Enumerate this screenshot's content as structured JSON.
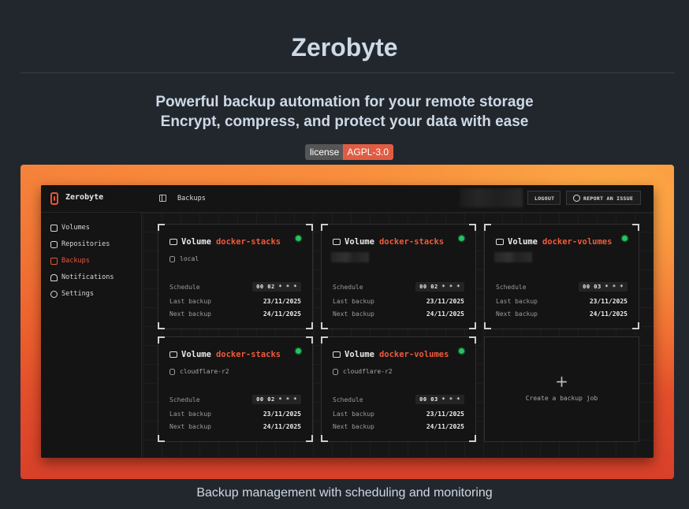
{
  "header": {
    "title": "Zerobyte",
    "tagline_1": "Powerful backup automation for your remote storage",
    "tagline_2": "Encrypt, compress, and protect your data with ease"
  },
  "badge": {
    "label": "license",
    "value": "AGPL-3.0",
    "value_color": "#e05d44"
  },
  "app": {
    "name": "Zerobyte",
    "breadcrumb": "Backups",
    "logout_label": "LOGOUT",
    "report_label": "REPORT AN ISSUE",
    "accent": "#ef5a3c",
    "sidebar": {
      "items": [
        {
          "label": "Volumes",
          "icon": "hard-drive-icon"
        },
        {
          "label": "Repositories",
          "icon": "database-icon"
        },
        {
          "label": "Backups",
          "icon": "backups-icon",
          "active": true
        },
        {
          "label": "Notifications",
          "icon": "bell-icon"
        },
        {
          "label": "Settings",
          "icon": "gear-icon"
        }
      ]
    },
    "row_labels": {
      "schedule": "Schedule",
      "last": "Last backup",
      "next": "Next backup"
    },
    "cards": [
      {
        "prefix": "Volume",
        "name": "docker-stacks",
        "repo": "local",
        "schedule": "00 02 * * *",
        "last": "23/11/2025",
        "next": "24/11/2025",
        "status": "healthy"
      },
      {
        "prefix": "Volume",
        "name": "docker-stacks",
        "repo": "",
        "schedule": "00 02 * * *",
        "last": "23/11/2025",
        "next": "24/11/2025",
        "status": "healthy"
      },
      {
        "prefix": "Volume",
        "name": "docker-volumes",
        "repo": "",
        "schedule": "00 03 * * *",
        "last": "23/11/2025",
        "next": "24/11/2025",
        "status": "healthy"
      },
      {
        "prefix": "Volume",
        "name": "docker-stacks",
        "repo": "cloudflare-r2",
        "schedule": "00 02 * * *",
        "last": "23/11/2025",
        "next": "24/11/2025",
        "status": "healthy"
      },
      {
        "prefix": "Volume",
        "name": "docker-volumes",
        "repo": "cloudflare-r2",
        "schedule": "00 03 * * *",
        "last": "23/11/2025",
        "next": "24/11/2025",
        "status": "healthy"
      }
    ],
    "create_label": "Create a backup job",
    "create_icon": "+",
    "status_color": "#22c55e"
  },
  "caption": "Backup management with scheduling and monitoring"
}
